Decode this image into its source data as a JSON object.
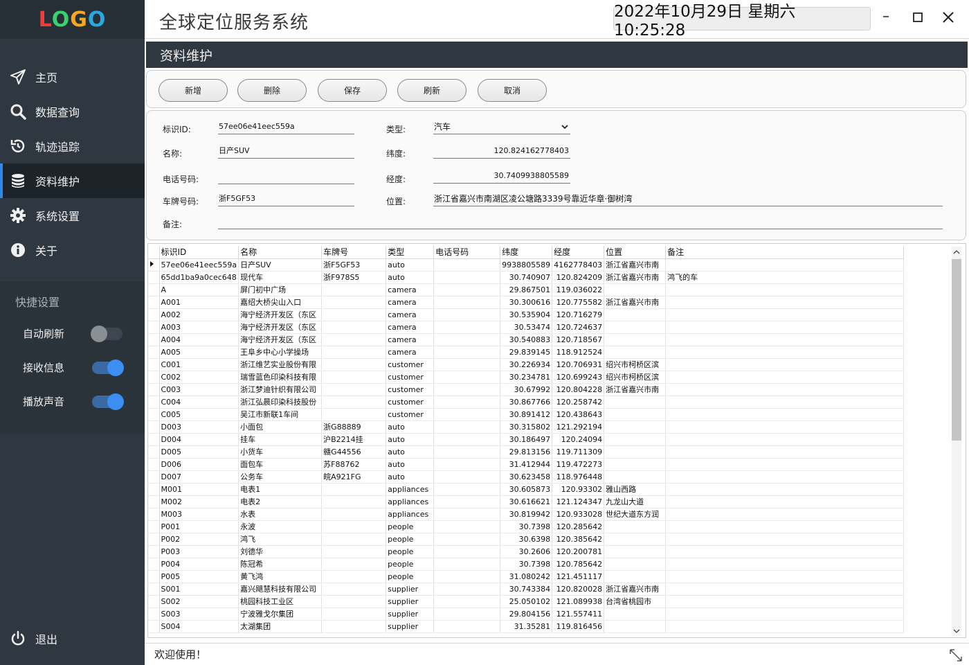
{
  "logo": [
    "L",
    "O",
    "G",
    "O"
  ],
  "app_title": "全球定位服务系统",
  "datetime": "2022年10月29日 星期六 10:25:28",
  "nav": [
    {
      "label": "主页",
      "icon": "send-icon"
    },
    {
      "label": "数据查询",
      "icon": "search-icon"
    },
    {
      "label": "轨迹追踪",
      "icon": "history-icon"
    },
    {
      "label": "资料维护",
      "icon": "database-icon",
      "active": true
    },
    {
      "label": "系统设置",
      "icon": "gear-icon"
    },
    {
      "label": "关于",
      "icon": "info-icon"
    }
  ],
  "quick": {
    "title": "快捷设置",
    "items": [
      {
        "label": "自动刷新",
        "on": false
      },
      {
        "label": "接收信息",
        "on": true
      },
      {
        "label": "播放声音",
        "on": true
      }
    ]
  },
  "exit_label": "退出",
  "section_title": "资料维护",
  "toolbar": {
    "add": "新增",
    "delete": "删除",
    "save": "保存",
    "refresh": "刷新",
    "cancel": "取消"
  },
  "form": {
    "id_label": "标识ID:",
    "id_value": "57ee06e41eec559a",
    "name_label": "名称:",
    "name_value": "日产SUV",
    "phone_label": "电话号码:",
    "phone_value": "",
    "plate_label": "车牌号码:",
    "plate_value": "浙F5GF53",
    "note_label": "备注:",
    "note_value": "",
    "type_label": "类型:",
    "type_value": "汽车",
    "lat_label": "纬度:",
    "lat_value": "120.824162778403",
    "lng_label": "经度:",
    "lng_value": "30.7409938805589",
    "pos_label": "位置:",
    "pos_value": "浙江省嘉兴市南湖区凌公塘路3339号靠近华章·御树湾"
  },
  "table": {
    "headers": [
      "标识ID",
      "名称",
      "车牌号",
      "类型",
      "电话号码",
      "纬度",
      "经度",
      "位置",
      "备注"
    ],
    "rows": [
      [
        "57ee06e41eec559a",
        "日产SUV",
        "浙F5GF53",
        "auto",
        "",
        "9938805589",
        "4162778403",
        "浙江省嘉兴市南",
        ""
      ],
      [
        "65dd1ba9a0cec648",
        "现代车",
        "浙F978S5",
        "auto",
        "",
        "30.740907",
        "120.824209",
        "浙江省嘉兴市南",
        "鸿飞的车"
      ],
      [
        "A",
        "屏门初中广场",
        "",
        "camera",
        "",
        "29.867501",
        "119.036022",
        "",
        ""
      ],
      [
        "A001",
        "嘉绍大桥尖山入口",
        "",
        "camera",
        "",
        "30.300616",
        "120.775582",
        "浙江省嘉兴市南",
        ""
      ],
      [
        "A002",
        "海宁经济开发区（东区",
        "",
        "camera",
        "",
        "30.535904",
        "120.716279",
        "",
        ""
      ],
      [
        "A003",
        "海宁经济开发区（东区",
        "",
        "camera",
        "",
        "30.53474",
        "120.724637",
        "",
        ""
      ],
      [
        "A004",
        "海宁经济开发区（东区",
        "",
        "camera",
        "",
        "30.540883",
        "120.718567",
        "",
        ""
      ],
      [
        "A005",
        "王阜乡中心小学操场",
        "",
        "camera",
        "",
        "29.839145",
        "118.912524",
        "",
        ""
      ],
      [
        "C001",
        "浙江维艺实业股份有限",
        "",
        "customer",
        "",
        "30.226934",
        "120.706931",
        "绍兴市柯桥区滨",
        ""
      ],
      [
        "C002",
        "瑞雪蓝色印染科技有限",
        "",
        "customer",
        "",
        "30.234781",
        "120.699243",
        "绍兴市柯桥区滨",
        ""
      ],
      [
        "C003",
        "浙江梦迪针织有限公司",
        "",
        "customer",
        "",
        "30.67992",
        "120.804228",
        "浙江省嘉兴市南",
        ""
      ],
      [
        "C004",
        "浙江弘晨印染科技股份",
        "",
        "customer",
        "",
        "30.867766",
        "120.258742",
        "",
        ""
      ],
      [
        "C005",
        "吴江市新联1车间",
        "",
        "customer",
        "",
        "30.891412",
        "120.438643",
        "",
        ""
      ],
      [
        "D003",
        "小面包",
        "浙G88889",
        "auto",
        "",
        "30.315802",
        "121.292194",
        "",
        ""
      ],
      [
        "D004",
        "挂车",
        "沪B2214挂",
        "auto",
        "",
        "30.186497",
        "120.24094",
        "",
        ""
      ],
      [
        "D005",
        "小货车",
        "赣G44556",
        "auto",
        "",
        "29.813156",
        "119.711309",
        "",
        ""
      ],
      [
        "D006",
        "面包车",
        "苏F88762",
        "auto",
        "",
        "31.412944",
        "119.472273",
        "",
        ""
      ],
      [
        "D007",
        "公务车",
        "皖A921FG",
        "auto",
        "",
        "30.623458",
        "118.976448",
        "",
        ""
      ],
      [
        "M001",
        "电表1",
        "",
        "appliances",
        "",
        "30.605873",
        "120.93302",
        "雅山西路",
        ""
      ],
      [
        "M002",
        "电表2",
        "",
        "appliances",
        "",
        "30.616621",
        "121.124347",
        "九龙山大道",
        ""
      ],
      [
        "M003",
        "水表",
        "",
        "appliances",
        "",
        "30.819942",
        "120.933028",
        "世纪大道东方润",
        ""
      ],
      [
        "P001",
        "永波",
        "",
        "people",
        "",
        "30.7398",
        "120.285642",
        "",
        ""
      ],
      [
        "P002",
        "鸿飞",
        "",
        "people",
        "",
        "30.6398",
        "120.385642",
        "",
        ""
      ],
      [
        "P003",
        "刘德华",
        "",
        "people",
        "",
        "30.2606",
        "120.200781",
        "",
        ""
      ],
      [
        "P004",
        "陈冠希",
        "",
        "people",
        "",
        "30.7398",
        "120.785642",
        "",
        ""
      ],
      [
        "P005",
        "黄飞鸿",
        "",
        "people",
        "",
        "31.080242",
        "121.451117",
        "",
        ""
      ],
      [
        "S001",
        "嘉兴飓慧科技有限公司",
        "",
        "supplier",
        "",
        "30.743384",
        "120.820028",
        "浙江省嘉兴市南",
        ""
      ],
      [
        "S002",
        "桃园科技工业区",
        "",
        "supplier",
        "",
        "25.050102",
        "121.089938",
        "台湾省桃园市",
        ""
      ],
      [
        "S003",
        "宁波雅戈尔集团",
        "",
        "supplier",
        "",
        "29.804156",
        "121.557411",
        "",
        ""
      ],
      [
        "S004",
        "太湖集团",
        "",
        "supplier",
        "",
        "31.35281",
        "119.816456",
        "",
        ""
      ]
    ]
  },
  "status_text": "欢迎使用！"
}
